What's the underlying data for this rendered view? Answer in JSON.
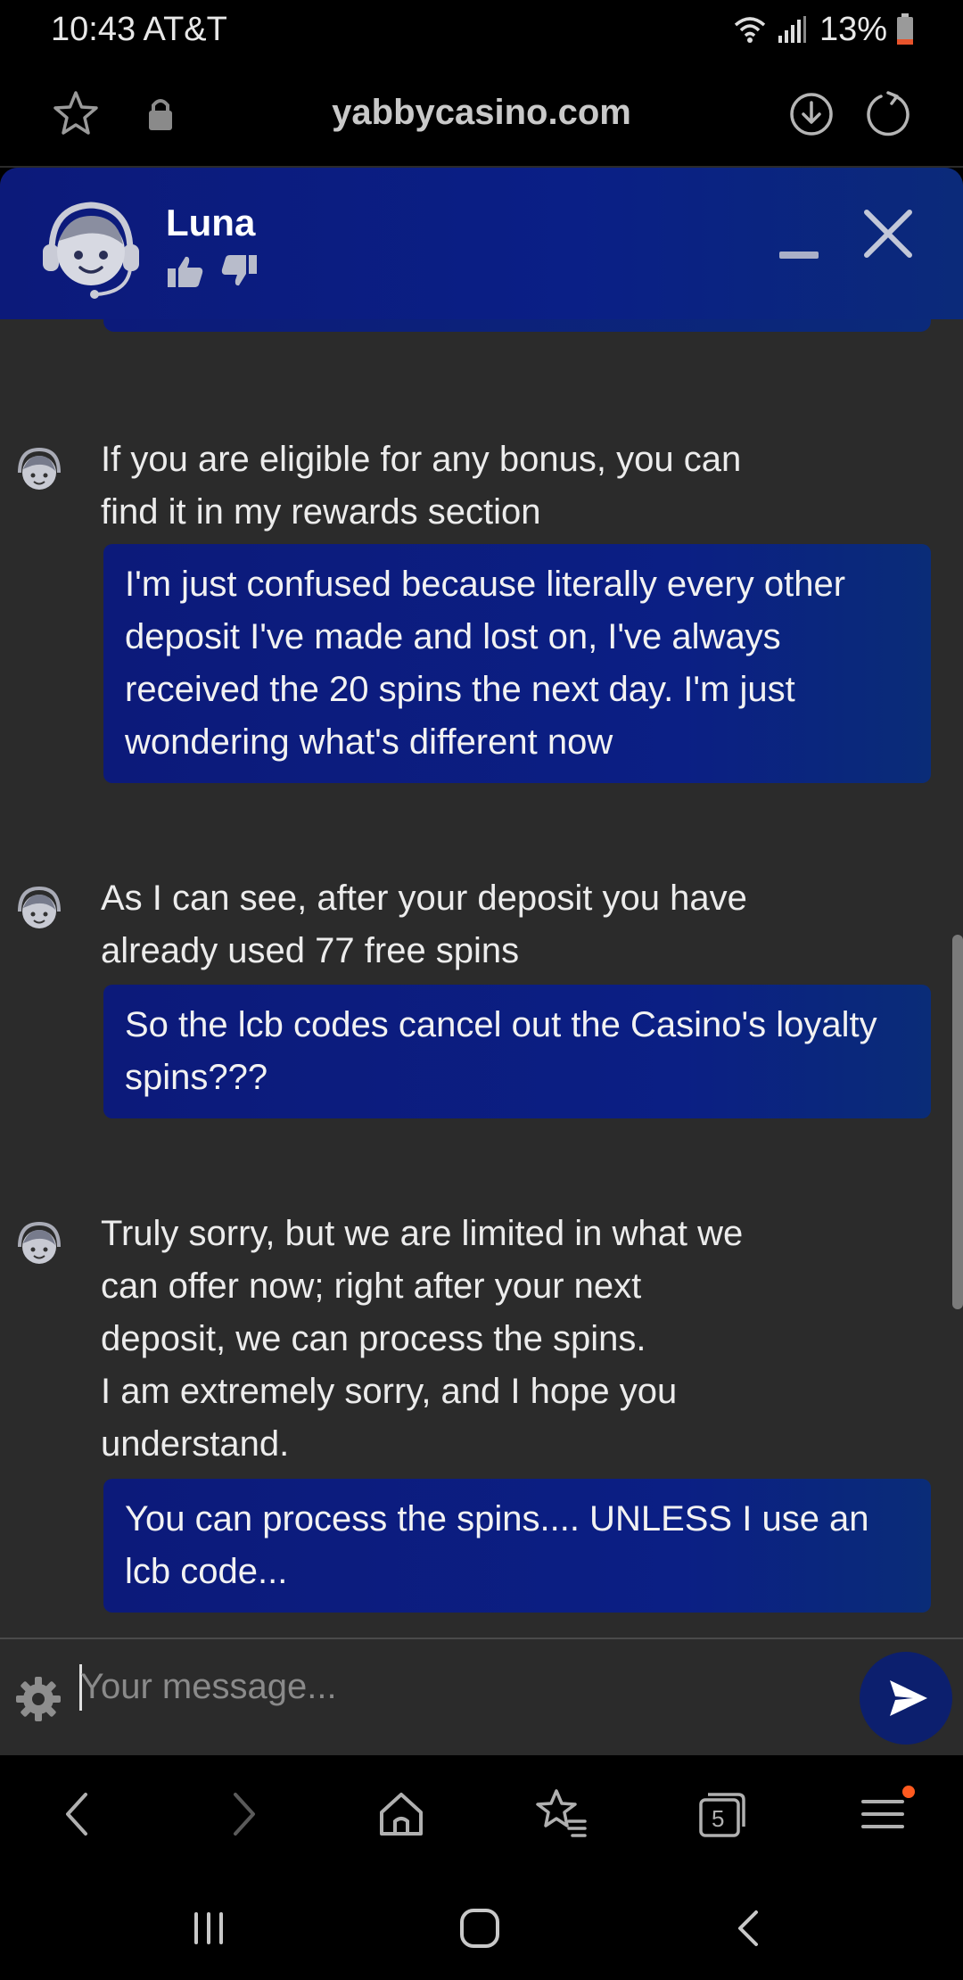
{
  "status_bar": {
    "time_carrier": "10:43 AT&T",
    "battery_pct": "13%"
  },
  "browser": {
    "url": "yabbycasino.com"
  },
  "chat": {
    "agent_name": "Luna",
    "input_placeholder": "Your message...",
    "messages": [
      {
        "from": "agent",
        "text": "If you are eligible for any bonus, you can\nfind it in my rewards section"
      },
      {
        "from": "user",
        "text": "I'm just confused because literally every other deposit I've made and lost on, I've always received the 20 spins the next day. I'm just wondering what's different now"
      },
      {
        "from": "agent",
        "text": "As I can see, after your deposit you have\nalready used 77 free spins"
      },
      {
        "from": "user",
        "text": "So the lcb codes cancel out the Casino's loyalty spins???"
      },
      {
        "from": "agent",
        "text": "Truly sorry, but we are limited in what we\ncan offer now; right after your next\ndeposit, we can process the spins.\nI am extremely sorry, and I hope you\nunderstand."
      },
      {
        "from": "user",
        "text": "You can process the spins.... UNLESS I use an lcb code..."
      }
    ]
  },
  "browser_nav": {
    "tabs_count": "5"
  },
  "colors": {
    "header_blue": "#0c1a7a",
    "chat_bg": "#2b2b2b",
    "notification_dot": "#ff5a1f"
  }
}
